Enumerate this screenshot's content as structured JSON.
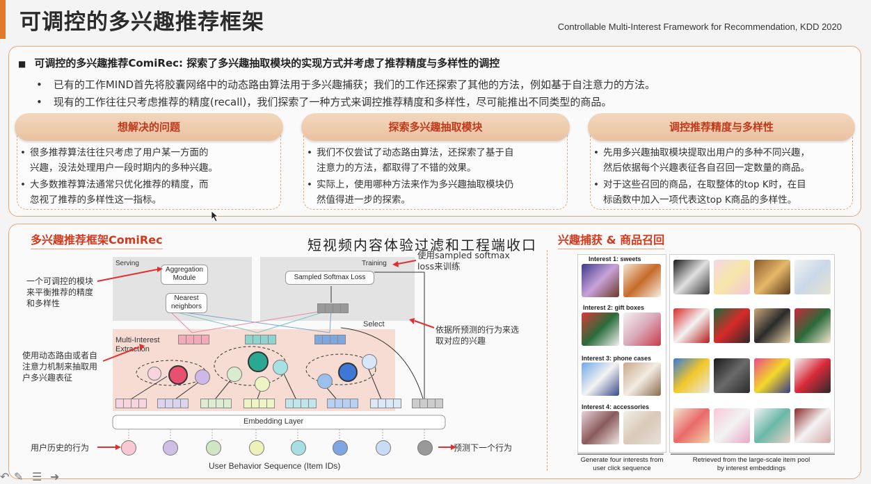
{
  "header": {
    "title": "可调控的多兴趣推荐框架",
    "reference": "Controllable Multi-Interest Framework for Recommendation, KDD 2020"
  },
  "summary": {
    "main": "可调控的多兴趣推荐ComiRec: 探索了多兴趣抽取模块的实现方式并考虑了推荐精度与多样性的调控",
    "sub1": "已有的工作MIND首先将胶囊网络中的动态路由算法用于多兴趣捕获；我们的工作还探索了其他的方法，例如基于自注意力的方法。",
    "sub2": "现有的工作往往只考虑推荐的精度(recall)，我们探索了一种方式来调控推荐精度和多样性，尽可能推出不同类型的商品。"
  },
  "cards": [
    {
      "title": "想解决的问题",
      "lines": [
        "很多推荐算法往往只考虑了用户某一方面的",
        "兴趣，没法处理用户一段时期内的多种兴趣。",
        "大多数推荐算法通常只优化推荐的精度，而",
        "忽视了推荐的多样性这一指标。"
      ]
    },
    {
      "title": "探索多兴趣抽取模块",
      "lines": [
        "我们不仅尝试了动态路由算法，还探索了基于自",
        "注意力的方法，都取得了不错的效果。",
        "实际上，使用哪种方法来作为多兴趣抽取模块仍",
        "然值得进一步的探索。"
      ]
    },
    {
      "title": "调控推荐精度与多样性",
      "lines": [
        "先用多兴趣抽取模块提取出用户的多种不同兴趣，",
        "然后依据每个兴趣表征各自召回一定数量的商品。",
        "对于这些召回的商品，在取整体的top K时，在目",
        "标函数中加入一项代表这top K商品的多样性。"
      ]
    }
  ],
  "framework": {
    "title": "多兴趣推荐框架ComiRec",
    "overlay": "短视频内容体验过滤和工程端收口",
    "serving": "Serving",
    "training": "Training",
    "aggregation": "Aggregation Module",
    "nearest": "Nearest neighbors",
    "sampled_softmax": "Sampled Softmax Loss",
    "multi_interest": "Multi-Interest Extraction",
    "select": "Select",
    "embedding": "Embedding Layer",
    "sequence": "User Behavior Sequence (Item IDs)",
    "ann_control": "一个可调控的模块来平衡推荐的精度和多样性",
    "ann_routing": "使用动态路由或者自注意力机制来抽取用户多兴趣表征",
    "ann_history": "用户历史的行为",
    "ann_softmax": "使用sampled softmax loss来训练",
    "ann_select": "依据所预测的行为来选取对应的兴趣",
    "ann_predict": "预测下一个行为"
  },
  "capture": {
    "title": "兴趣捕获 & 商品召回",
    "groups": [
      "Interest 1: sweets",
      "Interest 2: gift boxes",
      "Interest 3: phone cases",
      "Interest 4: accessories"
    ],
    "caption_left": "Generate four interests from user click sequence",
    "caption_right": "Retrieved from the large-scale item pool by interest embeddings"
  },
  "colors": {
    "accent": "#e07b2e",
    "title_red": "#d4391c",
    "card_head": "#e9c2a0"
  }
}
